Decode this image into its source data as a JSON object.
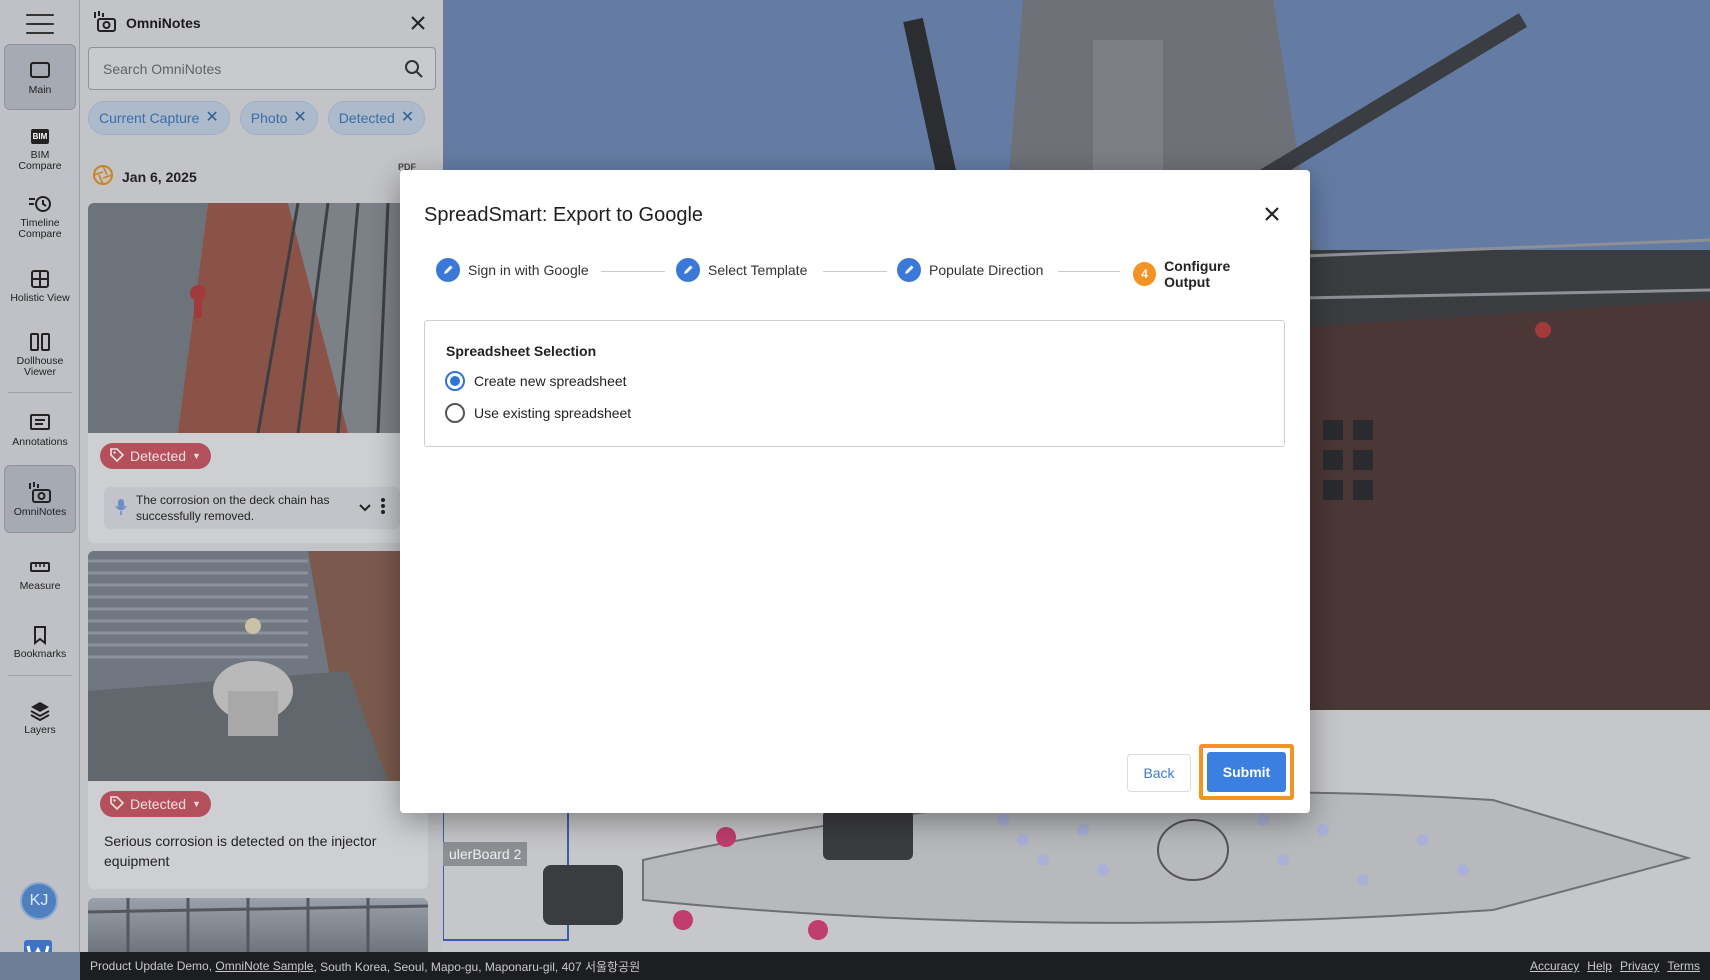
{
  "rail": {
    "items": [
      {
        "label": "Main"
      },
      {
        "label": "BIM Compare"
      },
      {
        "label": "Timeline Compare"
      },
      {
        "label": "Holistic View"
      },
      {
        "label": "Dollhouse Viewer"
      },
      {
        "label": "Annotations"
      },
      {
        "label": "OmniNotes"
      },
      {
        "label": "Measure"
      },
      {
        "label": "Bookmarks"
      },
      {
        "label": "Layers"
      }
    ],
    "bim_badge": "BIM",
    "avatar_initials": "KJ"
  },
  "panel": {
    "title": "OmniNotes",
    "search_placeholder": "Search OmniNotes",
    "chips": [
      "Current Capture",
      "Photo",
      "Detected"
    ],
    "date": "Jan 6, 2025",
    "pdf_label": "PDF",
    "cards": [
      {
        "badge": "Detected",
        "note": "The corrosion on the deck chain has successfully removed."
      },
      {
        "badge": "Detected",
        "note": "Serious corrosion is detected on the injector equipment"
      }
    ]
  },
  "plan": {
    "label": "ulerBoard 2"
  },
  "footer": {
    "prefix": "Product Update Demo, ",
    "link": "OmniNote Sample",
    "address": ", South Korea, Seoul, Mapo-gu, Maponaru-gil, 407 서울항공원",
    "links": [
      "Accuracy",
      "Help",
      "Privacy",
      "Terms"
    ]
  },
  "modal": {
    "title": "SpreadSmart: Export to Google",
    "steps": [
      {
        "label": "Sign in with Google",
        "state": "done"
      },
      {
        "label": "Select Template",
        "state": "done"
      },
      {
        "label": "Populate Direction",
        "state": "done"
      },
      {
        "label": "Configure Output",
        "state": "current",
        "number": "4"
      }
    ],
    "section_title": "Spreadsheet Selection",
    "options": [
      {
        "label": "Create new spreadsheet",
        "selected": true
      },
      {
        "label": "Use existing spreadsheet",
        "selected": false
      }
    ],
    "back_label": "Back",
    "submit_label": "Submit"
  },
  "colors": {
    "accent": "#3b78d8",
    "highlight": "#f39326",
    "badge": "#b3505c"
  }
}
